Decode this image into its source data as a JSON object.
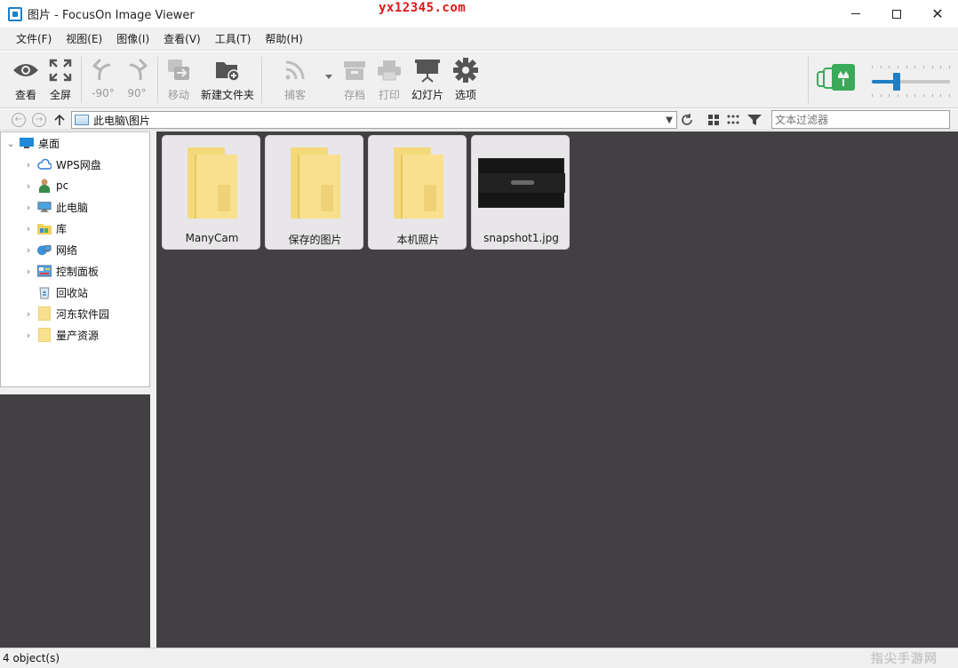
{
  "window": {
    "title": "图片 - FocusOn Image Viewer",
    "watermark_top": "yx12345.com",
    "watermark_bottom": "指尖手游网"
  },
  "menu": [
    "文件(F)",
    "视图(E)",
    "图像(I)",
    "查看(V)",
    "工具(T)",
    "帮助(H)"
  ],
  "toolbar": {
    "view": "查看",
    "fullscreen": "全屏",
    "rotate_left": "-90°",
    "rotate_right": "90°",
    "move": "移动",
    "new_folder": "新建文件夹",
    "capture": "捕客",
    "archive": "存档",
    "print": "打印",
    "slideshow": "幻灯片",
    "options": "选项",
    "zoom_level": 0.3
  },
  "address": {
    "path": "此电脑\\图片",
    "filter_placeholder": "文本过滤器"
  },
  "tree": [
    {
      "label": "桌面",
      "icon": "desktop-icon",
      "expanded": true
    },
    {
      "label": "WPS网盘",
      "icon": "cloud-icon"
    },
    {
      "label": "pc",
      "icon": "user-icon"
    },
    {
      "label": "此电脑",
      "icon": "computer-icon"
    },
    {
      "label": "库",
      "icon": "library-icon"
    },
    {
      "label": "网络",
      "icon": "network-icon"
    },
    {
      "label": "控制面板",
      "icon": "control-panel-icon"
    },
    {
      "label": "回收站",
      "icon": "recycle-bin-icon"
    },
    {
      "label": "河东软件园",
      "icon": "folder-icon"
    },
    {
      "label": "量产资源",
      "icon": "folder-icon"
    }
  ],
  "items": [
    {
      "name": "ManyCam",
      "type": "folder"
    },
    {
      "name": "保存的图片",
      "type": "folder"
    },
    {
      "name": "本机照片",
      "type": "folder"
    },
    {
      "name": "snapshot1.jpg",
      "type": "image"
    }
  ],
  "status": {
    "text": "4 object(s)"
  },
  "colors": {
    "accent": "#1e7fc4",
    "viewer_bg": "#434043",
    "folder": "#f8e08e",
    "watermark": "#e01515"
  }
}
